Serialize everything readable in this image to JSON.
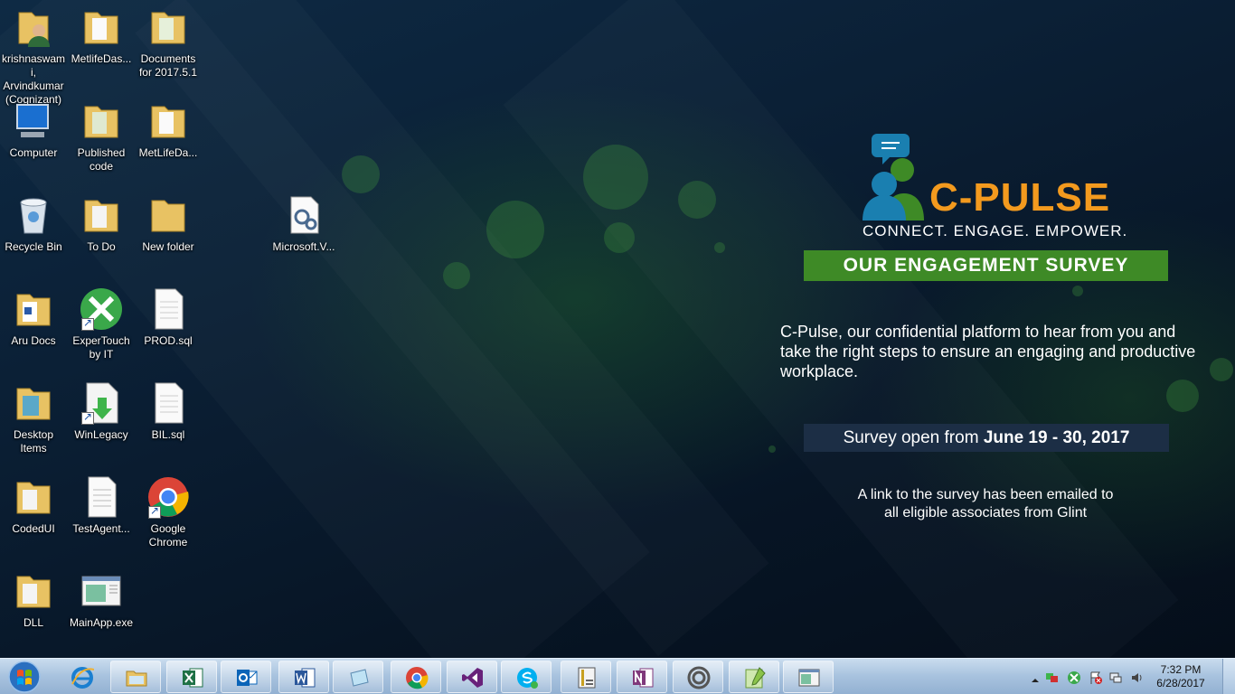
{
  "desktop": {
    "icons": [
      {
        "label": "krishnaswami, Arvindkumar (Cognizant)",
        "icon": "user-folder-icon"
      },
      {
        "label": "MetlifeDas...",
        "icon": "folder-icon"
      },
      {
        "label": "Documents for 2017.5.1",
        "icon": "folder-icon"
      },
      {
        "label": "Computer",
        "icon": "computer-icon"
      },
      {
        "label": "Published code",
        "icon": "folder-icon"
      },
      {
        "label": "MetLifeDa...",
        "icon": "folder-icon"
      },
      {
        "label": "Recycle Bin",
        "icon": "recycle-bin-icon"
      },
      {
        "label": "To Do",
        "icon": "folder-icon"
      },
      {
        "label": "New folder",
        "icon": "folder-icon"
      },
      {
        "label": "Microsoft.V...",
        "icon": "config-file-icon"
      },
      {
        "label": "Aru Docs",
        "icon": "folder-icon"
      },
      {
        "label": "ExperTouch by IT",
        "icon": "expertouch-icon"
      },
      {
        "label": "PROD.sql",
        "icon": "sql-file-icon"
      },
      {
        "label": "Desktop Items",
        "icon": "folder-icon"
      },
      {
        "label": "WinLegacy",
        "icon": "winlegacy-icon"
      },
      {
        "label": "BIL.sql",
        "icon": "sql-file-icon"
      },
      {
        "label": "CodedUI",
        "icon": "folder-icon"
      },
      {
        "label": "TestAgent...",
        "icon": "text-file-icon"
      },
      {
        "label": "Google Chrome",
        "icon": "chrome-icon"
      },
      {
        "label": "DLL",
        "icon": "folder-icon"
      },
      {
        "label": "MainApp.exe",
        "icon": "app-window-icon"
      }
    ]
  },
  "promo": {
    "brand_name": "C-PULSE",
    "tagline": "CONNECT. ENGAGE. EMPOWER.",
    "survey_title": "OUR ENGAGEMENT SURVEY",
    "intro": "C-Pulse, our confidential platform to hear from you and take the right steps to ensure an engaging and productive workplace.",
    "dates_prefix": "Survey open from",
    "dates_bold": "June 19 - 30, 2017",
    "link_line1": "A link to the survey has been emailed to",
    "link_line2": "all eligible associates from Glint"
  },
  "taskbar": {
    "pinned": [
      {
        "app": "Internet Explorer",
        "icon": "ie-icon"
      },
      {
        "app": "Windows Explorer",
        "icon": "explorer-icon"
      },
      {
        "app": "Excel",
        "icon": "excel-icon"
      },
      {
        "app": "Outlook",
        "icon": "outlook-icon"
      },
      {
        "app": "Word",
        "icon": "word-icon"
      },
      {
        "app": "Notepad",
        "icon": "notepad-icon"
      },
      {
        "app": "Chrome",
        "icon": "chrome-icon"
      },
      {
        "app": "Visual Studio",
        "icon": "visual-studio-icon"
      },
      {
        "app": "Skype",
        "icon": "skype-icon"
      },
      {
        "app": "SQL Server",
        "icon": "sql-server-icon"
      },
      {
        "app": "OneNote",
        "icon": "onenote-icon"
      },
      {
        "app": "Spiral App",
        "icon": "spiral-icon"
      },
      {
        "app": "Notepad++",
        "icon": "notepadpp-icon"
      },
      {
        "app": "MainApp",
        "icon": "app-window-icon"
      }
    ],
    "clock": {
      "time": "7:32 PM",
      "date": "6/28/2017"
    }
  },
  "colors": {
    "brand_orange": "#f39a1e",
    "survey_green": "#3e8a26",
    "dates_bg": "#1c2e45",
    "taskbar": "#a7c2de"
  }
}
